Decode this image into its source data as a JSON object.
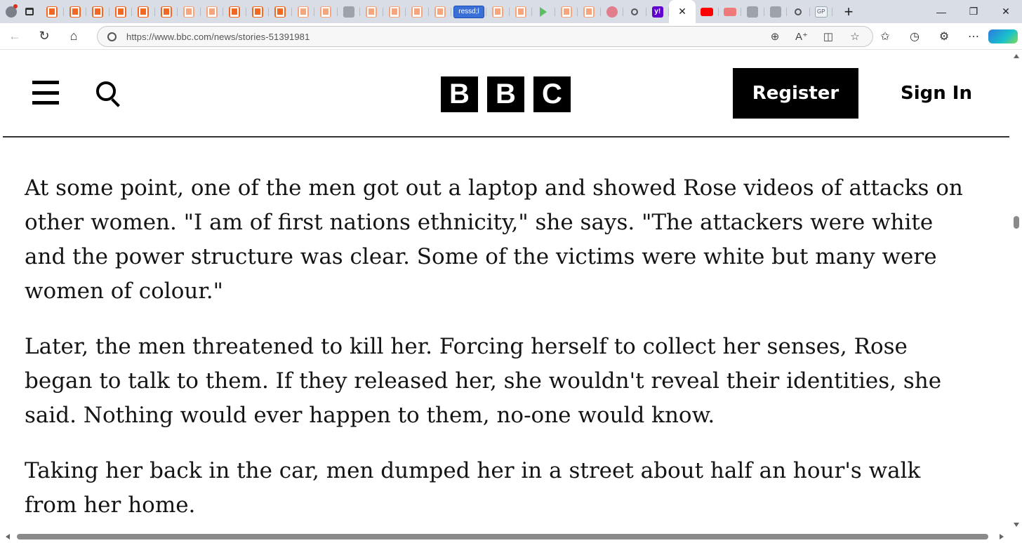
{
  "browser": {
    "tab_badge_text": "ressd;l",
    "yahoo_badge_text": "y!",
    "gp_badge_text": "GP",
    "active_tab_close": "✕",
    "new_tab_symbol": "+",
    "url": "https://www.bbc.com/news/stories-51391981",
    "window_controls": {
      "minimize": "—",
      "restore": "❐",
      "close": "✕"
    }
  },
  "header": {
    "logo_letters": [
      "B",
      "B",
      "C"
    ],
    "register_label": "Register",
    "signin_label": "Sign In"
  },
  "article": {
    "paragraphs": [
      "At some point, one of the men got out a laptop and showed Rose videos of attacks on other women. \"I am of first nations ethnicity,\" she says. \"The attackers were white and the power structure was clear. Some of the victims were white but many were women of colour.\"",
      "Later, the men threatened to kill her. Forcing herself to collect her senses, Rose began to talk to them. If they released her, she wouldn't reveal their identities, she said. Nothing would ever happen to them, no-one would know.",
      "Taking her back in the car, men dumped her in a street about half an hour's walk from her home."
    ]
  },
  "colors": {
    "brand_black": "#000000",
    "tabstrip_bg": "#d8dde6",
    "favicon_orange": "#f26722"
  }
}
